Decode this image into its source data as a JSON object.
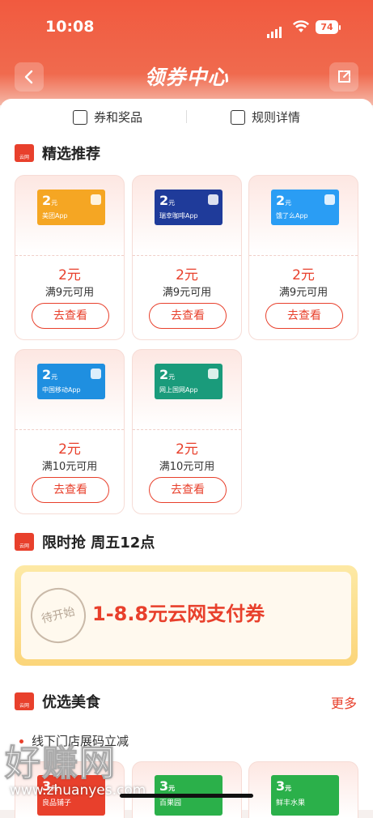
{
  "status": {
    "time": "10:08",
    "battery": "74"
  },
  "nav": {
    "title": "领券中心"
  },
  "tabs": [
    {
      "label": "券和奖品"
    },
    {
      "label": "规则详情"
    }
  ],
  "featured": {
    "title": "精选推荐",
    "coupons": [
      {
        "amount": "2",
        "unit": "元",
        "brand": "美团App",
        "badge": "美团",
        "color": "#f5a623",
        "price": "2元",
        "condition": "满9元可用",
        "button": "去查看"
      },
      {
        "amount": "2",
        "unit": "元",
        "brand": "瑞幸咖啡App",
        "badge": "",
        "color": "#1f3b9a",
        "price": "2元",
        "condition": "满9元可用",
        "button": "去查看"
      },
      {
        "amount": "2",
        "unit": "元",
        "brand": "饿了么App",
        "badge": "",
        "color": "#2a9df4",
        "price": "2元",
        "condition": "满9元可用",
        "button": "去查看"
      },
      {
        "amount": "2",
        "unit": "元",
        "brand": "中国移动App",
        "badge": "",
        "color": "#1f8fe0",
        "price": "2元",
        "condition": "满10元可用",
        "button": "去查看"
      },
      {
        "amount": "2",
        "unit": "元",
        "brand": "网上国网App",
        "badge": "",
        "color": "#1a9b7b",
        "price": "2元",
        "condition": "满10元可用",
        "button": "去查看"
      }
    ]
  },
  "flash_sale": {
    "title": "限时抢 周五12点",
    "stamp": "待开始",
    "offer": "1-8.8元云网支付券"
  },
  "food": {
    "title": "优选美食",
    "more": "更多",
    "tag": "线下门店展码立减",
    "coupons": [
      {
        "amount": "3",
        "unit": "元",
        "brand": "良品铺子",
        "color": "#e8402c"
      },
      {
        "amount": "3",
        "unit": "元",
        "brand": "百果园",
        "color": "#2bb04a"
      },
      {
        "amount": "3",
        "unit": "元",
        "brand": "鲜丰水果",
        "color": "#2bb04a"
      }
    ]
  },
  "watermark": {
    "brand": "好赚网",
    "url": "www.zhuanyes.com"
  },
  "colors": {
    "primary": "#e8402c",
    "header": "#f15a3f"
  }
}
